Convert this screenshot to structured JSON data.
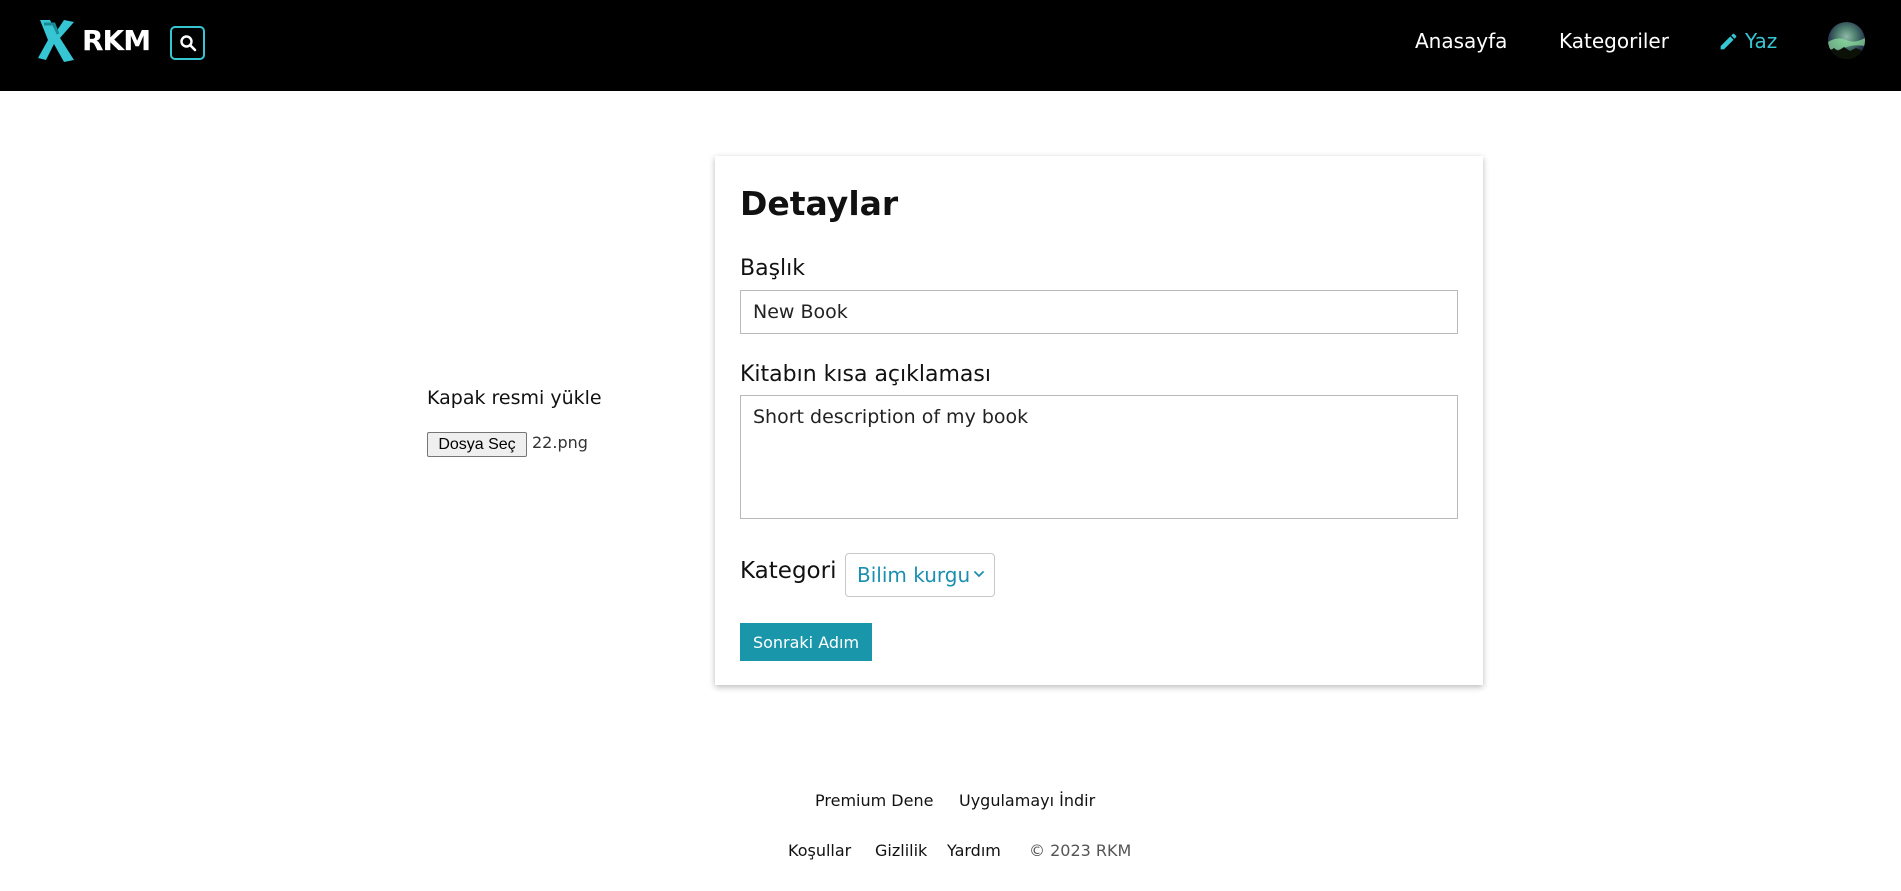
{
  "header": {
    "logo_text": "RKM",
    "nav": {
      "home": "Anasayfa",
      "categories": "Kategoriler",
      "write": "Yaz"
    },
    "accent_color": "#36c6d3"
  },
  "cover": {
    "label": "Kapak resmi yükle",
    "file_button": "Dosya Seç",
    "file_name": "22.png"
  },
  "form": {
    "title": "Detaylar",
    "title_label": "Başlık",
    "title_value": "New Book",
    "description_label": "Kitabın kısa açıklaması",
    "description_value": "Short description of my book",
    "category_label": "Kategori",
    "category_selected": "Bilim kurgu",
    "next_button": "Sonraki Adım",
    "button_color": "#1a96ab"
  },
  "footer": {
    "premium": "Premium Dene",
    "app": "Uygulamayı İndir",
    "terms": "Koşullar",
    "privacy": "Gizlilik",
    "help": "Yardım",
    "copyright": "© 2023 RKM"
  },
  "icons": {
    "logo": "rkm-logo-icon",
    "search": "search-icon",
    "write": "pencil-icon",
    "select": "chevron-down-icon"
  }
}
